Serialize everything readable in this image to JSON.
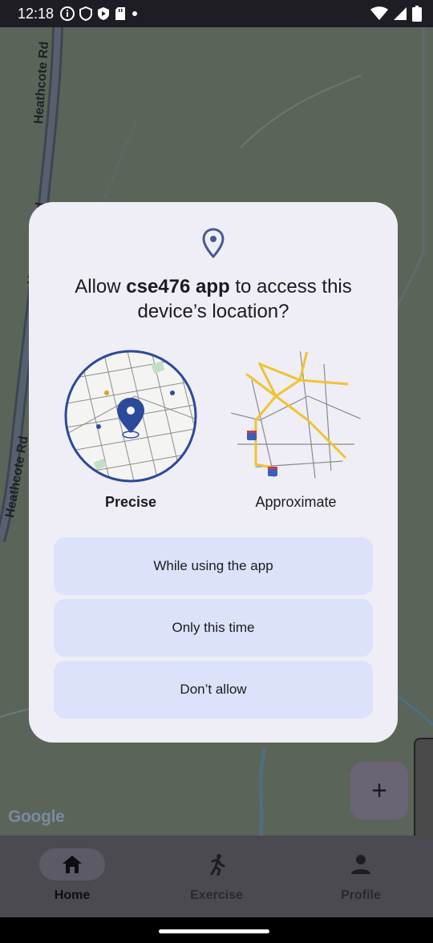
{
  "status_bar": {
    "time": "12:18",
    "left_icons": [
      "info-icon",
      "shield-icon",
      "play-protect-icon",
      "sd-card-icon",
      "dot-icon"
    ],
    "right_icons": [
      "wifi-icon",
      "signal-icon",
      "battery-icon"
    ]
  },
  "map": {
    "road_name": "Heathcote Rd",
    "logo": "Google"
  },
  "dialog": {
    "title_prefix": "Allow ",
    "app_name": "cse476 app",
    "title_suffix": " to access this device’s location?",
    "options": [
      {
        "label": "Precise",
        "selected": true
      },
      {
        "label": "Approximate",
        "selected": false
      }
    ],
    "buttons": {
      "while_using": "While using the app",
      "only_this_time": "Only this time",
      "dont_allow": "Don’t allow"
    },
    "colors": {
      "accent": "#2c4a9a",
      "button_bg": "#dce2fa",
      "surface": "#efeef6"
    }
  },
  "fab": {
    "label": "+"
  },
  "bottom_nav": {
    "items": [
      {
        "label": "Home",
        "icon": "home-icon",
        "active": true
      },
      {
        "label": "Exercise",
        "icon": "run-icon",
        "active": false
      },
      {
        "label": "Profile",
        "icon": "person-icon",
        "active": false
      }
    ]
  }
}
